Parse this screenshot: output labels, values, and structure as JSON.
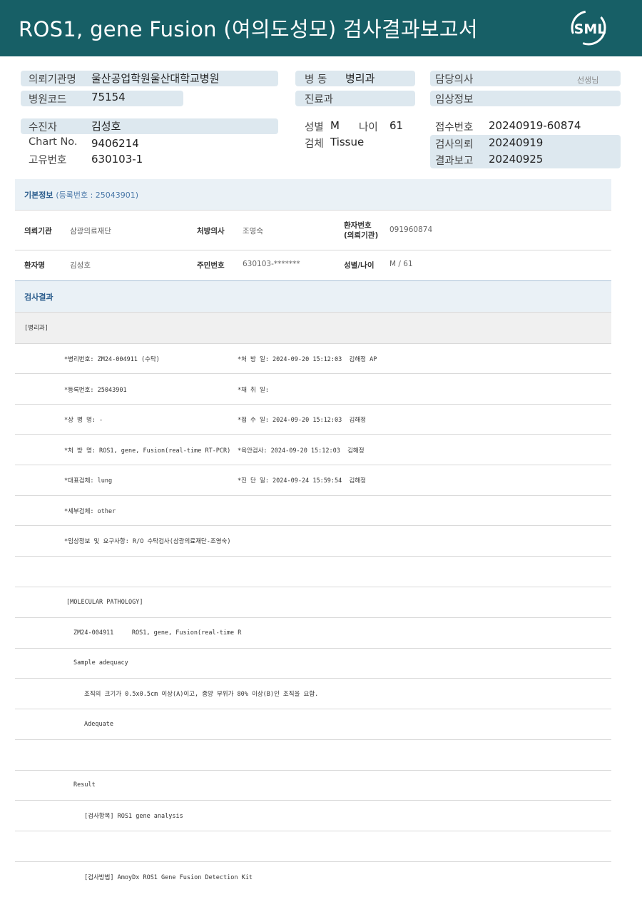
{
  "header": {
    "title": "ROS1, gene Fusion (여의도성모) 검사결과보고서",
    "logo_text": "SML",
    "bg_color": "#175f66"
  },
  "summary": {
    "requesting_institution_label": "의뢰기관명",
    "requesting_institution_value": "울산공업학원울산대학교병원",
    "hospital_code_label": "병원코드",
    "hospital_code_value": "75154",
    "ward_label": "병 동",
    "ward_value": "병리과",
    "department_label": "진료과",
    "department_value": "",
    "attending_doctor_label": "담당의사",
    "attending_doctor_value": "",
    "attending_doctor_suffix": "선생님",
    "clinical_info_label": "임상정보",
    "clinical_info_value": "",
    "patient_label": "수진자",
    "patient_value": "김성호",
    "chart_no_label": "Chart No.",
    "chart_no_value": "9406214",
    "unique_no_label": "고유번호",
    "unique_no_value": "630103-1",
    "sex_label": "성별",
    "sex_value": "M",
    "age_label": "나이",
    "age_value": "61",
    "specimen_label": "검체",
    "specimen_value": "Tissue",
    "receipt_no_label": "접수번호",
    "receipt_no_value": "20240919-60874",
    "test_request_label": "검사의뢰",
    "test_request_value": "20240919",
    "result_report_label": "결과보고",
    "result_report_value": "20240925"
  },
  "basic_info": {
    "title": "기본정보",
    "registration": "(등록번호 : 25043901)",
    "institution_label": "의뢰기관",
    "institution_value": "삼광의료재단",
    "prescriber_label": "처방의사",
    "prescriber_value": "조영숙",
    "patient_no_label_1": "환자번호",
    "patient_no_label_2": "(의뢰기관)",
    "patient_no_value": "091960874",
    "patient_name_label": "환자명",
    "patient_name_value": "김성호",
    "resident_no_label": "주민번호",
    "resident_no_value": "630103-*******",
    "sex_age_label": "성별/나이",
    "sex_age_value": "M / 61"
  },
  "results": {
    "title": "검사결과",
    "department_tag": "[병리과]",
    "lines": [
      {
        "left": "*병리번호: ZM24-004911 (수탁)",
        "right": "*처 방 일: 2024-09-20 15:12:03  김해정 AP"
      },
      {
        "left": "*등록번호: 25043901",
        "right": "*채 취 일:"
      },
      {
        "left": "*상 병 명: -",
        "right": "*접 수 일: 2024-09-20 15:12:03  김해정"
      },
      {
        "left": "*처 방 명: ROS1, gene, Fusion(real-time RT-PCR)",
        "right": "*육안검사: 2024-09-20 15:12:03  김해정"
      },
      {
        "left": "*대표검체: lung",
        "right": "*진 단 일: 2024-09-24 15:59:54  김해정"
      },
      {
        "left": "*세부검체: other",
        "right": ""
      },
      {
        "left": "*임상정보 및 요구사항: R/O 수탁검사(삼광의료재단-조영숙)",
        "right": ""
      }
    ],
    "molecular_header": "[MOLECULAR PATHOLOGY]",
    "case_line": "ZM24-004911     ROS1, gene, Fusion(real-time R",
    "sample_adequacy": "Sample adequacy",
    "adequacy_text": "조직의 크기가 0.5x0.5cm 이상(A)이고, 종양 부위가 80% 이상(B)인 조직을 요함.",
    "adequate": "Adequate",
    "result_label": "Result",
    "test_item": "[검사항목] ROS1 gene analysis",
    "test_method": "[검사방법] AmoyDx ROS1 Gene Fusion Detection Kit"
  }
}
